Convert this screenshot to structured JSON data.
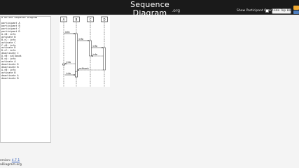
{
  "header": {
    "title": "Sequence Diagram",
    "subtitle": ".org",
    "overlay_label": "Show Participant Overlay",
    "hide_button": "Hide Top Bar"
  },
  "editor": {
    "lines": [
      "# Online Sequence Diagram",
      "",
      "participant A",
      "participant B",
      "participant C",
      "participant D",
      "A->B: info",
      "activate B",
      "B->C: info",
      "activate C",
      "C->D: info",
      "activate D",
      "D->C: info",
      "deactivate C",
      "D->B: callback",
      "B->A: info",
      "activate A",
      "deactivate D",
      "deactivate B",
      "A->B: info",
      "activate B",
      "deactivate A",
      "deactivate B"
    ]
  },
  "diagram": {
    "participants": [
      "A",
      "B",
      "C",
      "D"
    ],
    "messages": [
      {
        "label": "info"
      },
      {
        "label": "info"
      },
      {
        "label": "info"
      },
      {
        "label": "info"
      },
      {
        "label": "callback"
      },
      {
        "label": "info"
      },
      {
        "label": "info"
      }
    ]
  },
  "footer": {
    "version_prefix": "ersion: ",
    "version": "4.7.1",
    "site": "aDiagram.org"
  }
}
